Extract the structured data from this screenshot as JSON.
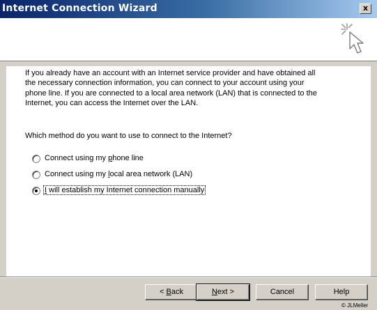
{
  "window": {
    "title": "Internet Connection Wizard",
    "close_glyph": "x"
  },
  "header": {
    "icon": "wizard-cursor-icon"
  },
  "body": {
    "intro_lines": [
      "If you already have an account with an Internet service provider and have obtained all",
      "the necessary connection information, you can connect to your account using your",
      "phone line. If you are connected to a local area network (LAN) that is connected to the",
      "Internet, you can access the Internet over the LAN."
    ],
    "question": "Which method do you want to use to connect to the Internet?",
    "options": [
      {
        "pre": "Connect using my ",
        "key": "p",
        "post": "hone line",
        "selected": false
      },
      {
        "pre": "Connect using my ",
        "key": "l",
        "post": "ocal area network (LAN)",
        "selected": false
      },
      {
        "pre": "",
        "key": "I",
        "post": " will establish my Internet connection manually",
        "selected": true
      }
    ]
  },
  "footer": {
    "buttons": [
      {
        "pre": "< ",
        "key": "B",
        "post": "ack"
      },
      {
        "pre": "",
        "key": "N",
        "post": "ext >"
      },
      {
        "pre": "Cancel",
        "key": "",
        "post": ""
      },
      {
        "pre": "Help",
        "key": "",
        "post": ""
      }
    ],
    "copyright": "© JLMeller"
  },
  "colors": {
    "title_gradient_start": "#0a246a",
    "title_gradient_end": "#a6caf0",
    "dialog_face": "#d4d0c8"
  }
}
